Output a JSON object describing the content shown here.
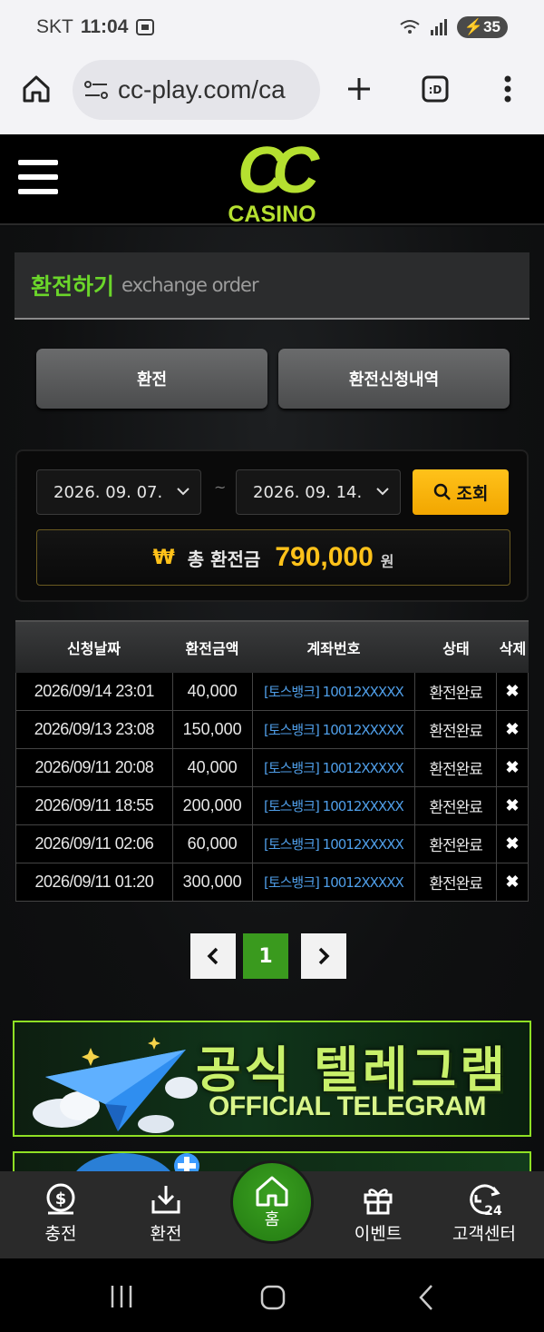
{
  "status_bar": {
    "carrier": "SKT",
    "time": "11:04",
    "battery": "35"
  },
  "browser": {
    "url": "cc-play.com/ca"
  },
  "site": {
    "logo_text": "CASINO",
    "logo_mark": "CC"
  },
  "page": {
    "title_ko": "환전하기",
    "title_en": "exchange order"
  },
  "tabs": [
    {
      "label": "환전"
    },
    {
      "label": "환전신청내역"
    }
  ],
  "filter": {
    "date_from": "2026. 09. 07.",
    "date_to": "2026. 09. 14.",
    "separator": "~",
    "search_label": "조회",
    "total_symbol": "₩",
    "total_label": "총 환전금",
    "total_amount": "790,000",
    "total_unit": "원"
  },
  "table": {
    "headers": [
      "신청날짜",
      "환전금액",
      "계좌번호",
      "상태",
      "삭제"
    ],
    "rows": [
      {
        "date": "2026/09/14 23:01",
        "amount": "40,000",
        "account": "[토스뱅크] 10012XXXXX",
        "status": "환전완료",
        "delete": "✖"
      },
      {
        "date": "2026/09/13 23:08",
        "amount": "150,000",
        "account": "[토스뱅크] 10012XXXXX",
        "status": "환전완료",
        "delete": "✖"
      },
      {
        "date": "2026/09/11 20:08",
        "amount": "40,000",
        "account": "[토스뱅크] 10012XXXXX",
        "status": "환전완료",
        "delete": "✖"
      },
      {
        "date": "2026/09/11 18:55",
        "amount": "200,000",
        "account": "[토스뱅크] 10012XXXXX",
        "status": "환전완료",
        "delete": "✖"
      },
      {
        "date": "2026/09/11 02:06",
        "amount": "60,000",
        "account": "[토스뱅크] 10012XXXXX",
        "status": "환전완료",
        "delete": "✖"
      },
      {
        "date": "2026/09/11 01:20",
        "amount": "300,000",
        "account": "[토스뱅크] 10012XXXXX",
        "status": "환전완료",
        "delete": "✖"
      }
    ]
  },
  "pagination": {
    "current": "1"
  },
  "banner": {
    "title": "공식 텔레그램",
    "subtitle": "OFFICIAL TELEGRAM"
  },
  "bottom_nav": [
    {
      "label": "충전",
      "icon": "dollar-coin-icon"
    },
    {
      "label": "환전",
      "icon": "download-icon"
    },
    {
      "label": "홈",
      "icon": "home-icon"
    },
    {
      "label": "이벤트",
      "icon": "gift-icon"
    },
    {
      "label": "고객센터",
      "icon": "support-24-icon"
    }
  ],
  "colors": {
    "accent_green": "#6bd62a",
    "gold": "#ffc21a",
    "link_blue": "#4f9ee8",
    "page_green": "#3a9a1e"
  }
}
